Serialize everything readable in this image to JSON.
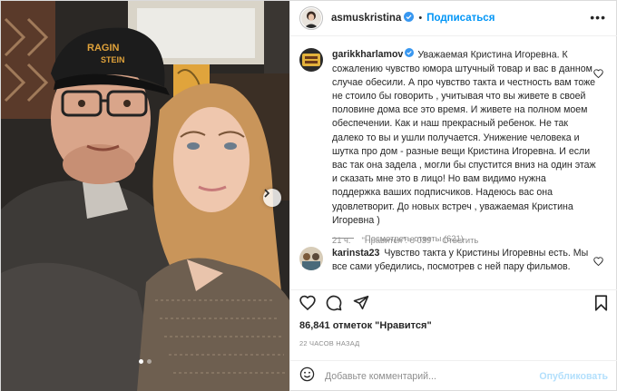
{
  "post": {
    "author": "asmuskristina",
    "follow_label": "Подписаться",
    "separator": "•",
    "more_glyph": "•••"
  },
  "comments": [
    {
      "username": "garikkharlamov",
      "text": "Уважаемая Кристина Игоревна. К сожалению чувство юмора штучный товар и вас в данном случае обесили. А про чувство такта и честность вам тоже не стоило бы говорить , учитывая что вы живете в своей половине дома все это время. И живете на полном моем обеспечении. Как и наш прекрасный ребенок. Не так далеко то вы и ушли получается. Унижение человека и шутка про дом - разные вещи Кристина Игоревна. И если вас так она задела , могли бы спустится вниз на один этаж и сказать мне это в лицо! Но вам видимо нужна поддержка ваших подписчиков. Надеюсь вас она удовлетворит. До новых встреч , уважаемая Кристина Игоревна )",
      "time": "21 ч.",
      "likes": "\"Нравится\": 8 039",
      "reply": "Ответить",
      "view_replies": "Посмотреть ответы (621)"
    },
    {
      "username": "karinsta23",
      "text": "Чувство такта у Кристины Игоревны есть. Мы все сами убедились, посмотрев с ней пару фильмов."
    }
  ],
  "actions": {
    "like_icon": "heart-icon",
    "comment_icon": "comment-icon",
    "share_icon": "share-icon",
    "save_icon": "bookmark-icon"
  },
  "likes_text": "86,841 отметок \"Нравится\"",
  "posted_time": "22 ЧАСОВ НАЗАД",
  "add_comment": {
    "placeholder": "Добавьте комментарий...",
    "publish_label": "Опубликовать"
  },
  "carousel": {
    "slide_count": 2,
    "active_slide": 1
  },
  "colors": {
    "link_blue": "#0095f6",
    "publish_disabled": "#b2dffc",
    "secondary_text": "#8e8e8e",
    "verified_blue": "#3897f0"
  }
}
